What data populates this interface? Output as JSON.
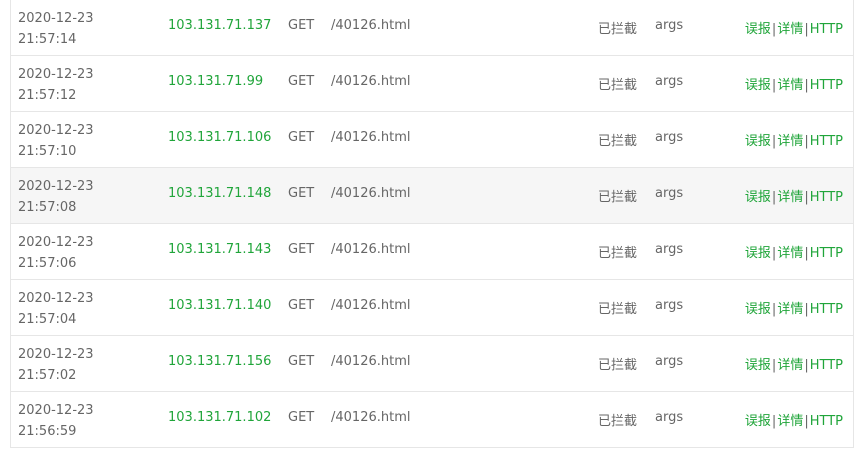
{
  "rows": [
    {
      "date": "2020-12-23",
      "time": "21:57:14",
      "ip": "103.131.71.137",
      "method": "GET",
      "uri": "/40126.html",
      "status": "已拦截",
      "type": "args"
    },
    {
      "date": "2020-12-23",
      "time": "21:57:12",
      "ip": "103.131.71.99",
      "method": "GET",
      "uri": "/40126.html",
      "status": "已拦截",
      "type": "args"
    },
    {
      "date": "2020-12-23",
      "time": "21:57:10",
      "ip": "103.131.71.106",
      "method": "GET",
      "uri": "/40126.html",
      "status": "已拦截",
      "type": "args"
    },
    {
      "date": "2020-12-23",
      "time": "21:57:08",
      "ip": "103.131.71.148",
      "method": "GET",
      "uri": "/40126.html",
      "status": "已拦截",
      "type": "args"
    },
    {
      "date": "2020-12-23",
      "time": "21:57:06",
      "ip": "103.131.71.143",
      "method": "GET",
      "uri": "/40126.html",
      "status": "已拦截",
      "type": "args"
    },
    {
      "date": "2020-12-23",
      "time": "21:57:04",
      "ip": "103.131.71.140",
      "method": "GET",
      "uri": "/40126.html",
      "status": "已拦截",
      "type": "args"
    },
    {
      "date": "2020-12-23",
      "time": "21:57:02",
      "ip": "103.131.71.156",
      "method": "GET",
      "uri": "/40126.html",
      "status": "已拦截",
      "type": "args"
    },
    {
      "date": "2020-12-23",
      "time": "21:56:59",
      "ip": "103.131.71.102",
      "method": "GET",
      "uri": "/40126.html",
      "status": "已拦截",
      "type": "args"
    }
  ],
  "actions": {
    "report": "误报",
    "details": "详情",
    "http": "HTTP",
    "separator": "|"
  },
  "colors": {
    "accent": "#20a53a",
    "text": "#666666",
    "border": "#e6e6e6",
    "hover_row": "#f6f6f6"
  }
}
